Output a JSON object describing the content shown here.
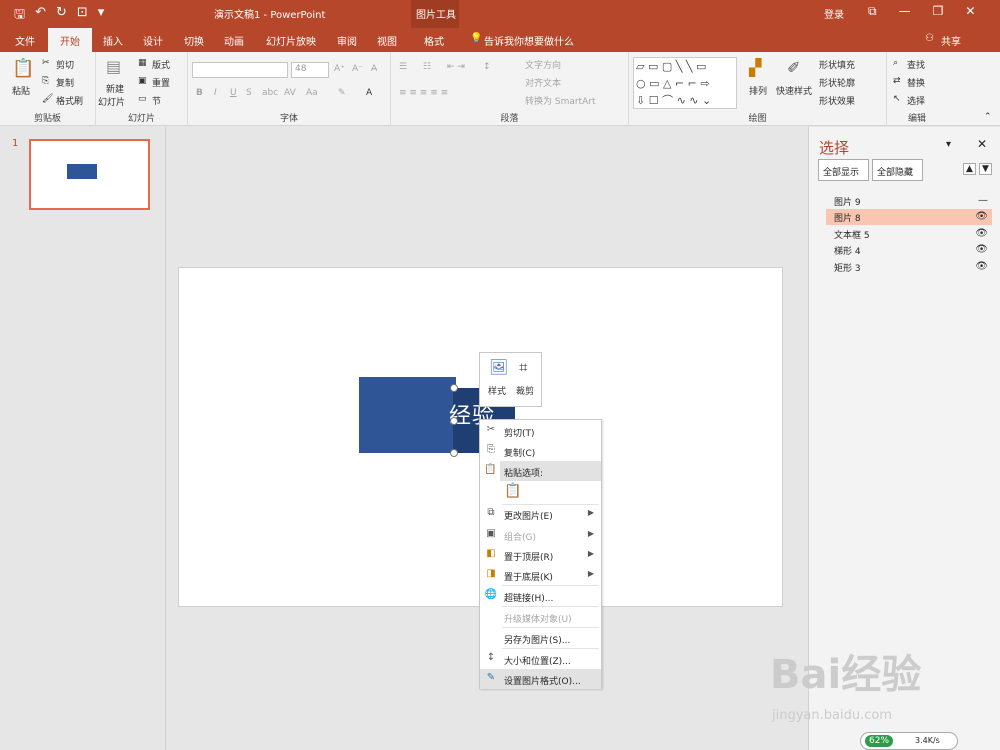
{
  "titlebar": {
    "title": "演示文稿1 - PowerPoint",
    "context_title": "图片工具",
    "login": "登录",
    "share": "共享"
  },
  "tabs": [
    "文件",
    "开始",
    "插入",
    "设计",
    "切换",
    "动画",
    "幻灯片放映",
    "审阅",
    "视图",
    "格式"
  ],
  "tellme": "告诉我你想要做什么",
  "ribbon": {
    "clipboard": {
      "paste": "粘贴",
      "cut": "剪切",
      "copy": "复制",
      "format_painter": "格式刷",
      "label": "剪贴板"
    },
    "slides": {
      "new_slide_1": "新建",
      "new_slide_2": "幻灯片",
      "layout": "版式",
      "reset": "重置",
      "section": "节",
      "label": "幻灯片"
    },
    "font": {
      "size": "48",
      "label": "字体"
    },
    "paragraph": {
      "text_direction": "文字方向",
      "align_text": "对齐文本",
      "smartart": "转换为 SmartArt",
      "label": "段落"
    },
    "drawing": {
      "arrange": "排列",
      "quick_styles": "快速样式",
      "fill": "形状填充",
      "outline": "形状轮廓",
      "effects": "形状效果",
      "label": "绘图"
    },
    "editing": {
      "find": "查找",
      "replace": "替换",
      "select": "选择",
      "label": "编辑"
    }
  },
  "slide_num": "1",
  "slide_text": "经验",
  "minitoolbar": {
    "style": "样式",
    "crop": "裁剪"
  },
  "menu": {
    "cut": "剪切(T)",
    "copy": "复制(C)",
    "paste_options": "粘贴选项:",
    "change_picture": "更改图片(E)",
    "group": "组合(G)",
    "bring_front": "置于顶层(R)",
    "send_back": "置于底层(K)",
    "hyperlink": "超链接(H)...",
    "upgrade_media": "升级媒体对象(U)",
    "save_as_picture": "另存为图片(S)...",
    "size_position": "大小和位置(Z)...",
    "format_picture": "设置图片格式(O)..."
  },
  "selection_pane": {
    "title": "选择",
    "show_all": "全部显示",
    "hide_all": "全部隐藏",
    "layers": [
      "图片 9",
      "图片 8",
      "文本框 5",
      "梯形 4",
      "矩形 3"
    ]
  },
  "watermark": {
    "logo": "Bai经验",
    "url": "jingyan.baidu.com"
  },
  "speed": {
    "percent": "62%",
    "rate": "3.4K/s"
  },
  "colors": {
    "accent": "#b7472a",
    "shape": "#2f5597",
    "selected_layer": "#f9c6b1"
  }
}
